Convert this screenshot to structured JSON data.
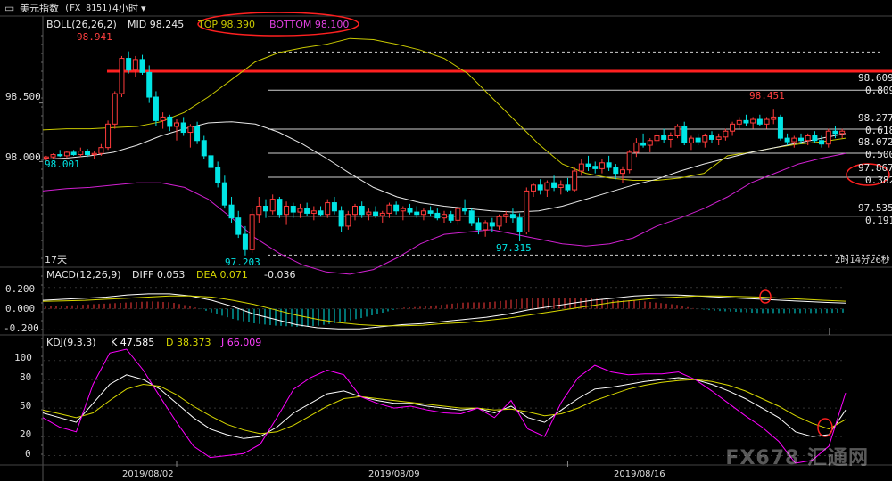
{
  "header": {
    "title": "美元指数",
    "code": "(FX 8151)",
    "period": "4小时",
    "period_arrow": "▾",
    "menu_icon": "menu-icon"
  },
  "boll_legend": {
    "label": "BOLL(26,26,2)",
    "mid": "MID 98.245",
    "top": "TOP 98.390",
    "bottom": "BOTTOM 98.100"
  },
  "macd_legend": {
    "label": "MACD(12,26,9)",
    "diff": "DIFF 0.053",
    "dea": "DEA 0.071",
    "macd": "-0.036"
  },
  "kdj_legend": {
    "label": "KDJ(9,3,3)",
    "k": "K 47.585",
    "d": "D 38.373",
    "j": "J 66.009"
  },
  "bottom_left_label": "17天",
  "countdown": "2时14分26秒",
  "watermark": "FX678 汇通网",
  "colors": {
    "up": "#ff3b3b",
    "down": "#00e5e5",
    "boll_top": "#c8c800",
    "boll_mid": "#e8e8e8",
    "boll_bottom": "#d020d0",
    "resistance": "#ff2020",
    "fib_line": "#d0d0d0",
    "k": "#ffffff",
    "d": "#d8d800",
    "j": "#ff00ff",
    "annotation": "#ff2020"
  },
  "chart_data": {
    "type": "candlestick",
    "title": "",
    "price_axis": {
      "ylim": [
        97.1,
        99.15
      ],
      "ticks": [
        "98.500",
        "98.000"
      ]
    },
    "x_axis": {
      "labels": [
        "2019/08/02",
        "2019/08/09",
        "2019/08/16"
      ],
      "label_candle_index": [
        19,
        76,
        133
      ]
    },
    "candles": [
      [
        98.03,
        98.05,
        98.0,
        98.04
      ],
      [
        98.04,
        98.07,
        98.02,
        98.06
      ],
      [
        98.06,
        98.1,
        98.04,
        98.05
      ],
      [
        98.05,
        98.09,
        98.03,
        98.08
      ],
      [
        98.08,
        98.1,
        98.05,
        98.06
      ],
      [
        98.06,
        98.12,
        98.04,
        98.09
      ],
      [
        98.09,
        98.11,
        98.04,
        98.06
      ],
      [
        98.06,
        98.09,
        98.02,
        98.07
      ],
      [
        98.07,
        98.15,
        98.05,
        98.12
      ],
      [
        98.12,
        98.35,
        98.1,
        98.32
      ],
      [
        98.32,
        98.6,
        98.28,
        98.58
      ],
      [
        98.58,
        98.9,
        98.55,
        98.88
      ],
      [
        98.88,
        98.94,
        98.75,
        98.78
      ],
      [
        98.78,
        98.9,
        98.72,
        98.87
      ],
      [
        98.87,
        98.91,
        98.74,
        98.76
      ],
      [
        98.76,
        98.82,
        98.5,
        98.55
      ],
      [
        98.55,
        98.6,
        98.3,
        98.35
      ],
      [
        98.35,
        98.42,
        98.28,
        98.38
      ],
      [
        98.38,
        98.4,
        98.26,
        98.3
      ],
      [
        98.3,
        98.36,
        98.18,
        98.33
      ],
      [
        98.33,
        98.38,
        98.22,
        98.25
      ],
      [
        98.25,
        98.32,
        98.12,
        98.3
      ],
      [
        98.3,
        98.34,
        98.15,
        98.18
      ],
      [
        98.18,
        98.22,
        98.02,
        98.05
      ],
      [
        98.05,
        98.1,
        97.92,
        97.95
      ],
      [
        97.95,
        98.0,
        97.78,
        97.82
      ],
      [
        97.82,
        97.88,
        97.6,
        97.63
      ],
      [
        97.63,
        97.7,
        97.48,
        97.52
      ],
      [
        97.52,
        97.58,
        97.35,
        97.38
      ],
      [
        97.38,
        97.45,
        97.2,
        97.25
      ],
      [
        97.25,
        97.6,
        97.22,
        97.55
      ],
      [
        97.55,
        97.7,
        97.48,
        97.62
      ],
      [
        97.62,
        97.68,
        97.52,
        97.58
      ],
      [
        97.58,
        97.72,
        97.55,
        97.68
      ],
      [
        97.68,
        97.7,
        97.52,
        97.55
      ],
      [
        97.55,
        97.66,
        97.46,
        97.62
      ],
      [
        97.62,
        97.65,
        97.52,
        97.57
      ],
      [
        97.57,
        97.64,
        97.52,
        97.6
      ],
      [
        97.6,
        97.65,
        97.54,
        97.56
      ],
      [
        97.56,
        97.62,
        97.5,
        97.58
      ],
      [
        97.58,
        97.62,
        97.53,
        97.55
      ],
      [
        97.55,
        97.68,
        97.52,
        97.65
      ],
      [
        97.65,
        97.7,
        97.55,
        97.58
      ],
      [
        97.58,
        97.62,
        97.4,
        97.45
      ],
      [
        97.45,
        97.58,
        97.42,
        97.55
      ],
      [
        97.55,
        97.64,
        97.5,
        97.62
      ],
      [
        97.62,
        97.66,
        97.52,
        97.55
      ],
      [
        97.55,
        97.6,
        97.5,
        97.57
      ],
      [
        97.57,
        97.62,
        97.52,
        97.54
      ],
      [
        97.54,
        97.58,
        97.48,
        97.56
      ],
      [
        97.56,
        97.65,
        97.52,
        97.63
      ],
      [
        97.63,
        97.66,
        97.55,
        97.58
      ],
      [
        97.58,
        97.62,
        97.5,
        97.6
      ],
      [
        97.6,
        97.64,
        97.55,
        97.57
      ],
      [
        97.57,
        97.62,
        97.52,
        97.55
      ],
      [
        97.55,
        97.6,
        97.5,
        97.58
      ],
      [
        97.58,
        97.62,
        97.53,
        97.56
      ],
      [
        97.56,
        97.6,
        97.5,
        97.52
      ],
      [
        97.52,
        97.58,
        97.48,
        97.55
      ],
      [
        97.55,
        97.58,
        97.48,
        97.5
      ],
      [
        97.5,
        97.62,
        97.46,
        97.6
      ],
      [
        97.6,
        97.68,
        97.55,
        97.58
      ],
      [
        97.58,
        97.6,
        97.45,
        97.48
      ],
      [
        97.48,
        97.52,
        97.38,
        97.42
      ],
      [
        97.42,
        97.5,
        97.36,
        97.48
      ],
      [
        97.48,
        97.52,
        97.4,
        97.45
      ],
      [
        97.45,
        97.55,
        97.42,
        97.53
      ],
      [
        97.53,
        97.58,
        97.48,
        97.55
      ],
      [
        97.55,
        97.6,
        97.48,
        97.52
      ],
      [
        97.52,
        97.56,
        97.32,
        97.4
      ],
      [
        97.4,
        97.78,
        97.38,
        97.75
      ],
      [
        97.75,
        97.82,
        97.7,
        97.8
      ],
      [
        97.8,
        97.85,
        97.72,
        97.76
      ],
      [
        97.76,
        97.84,
        97.7,
        97.82
      ],
      [
        97.82,
        97.88,
        97.75,
        97.78
      ],
      [
        97.78,
        97.84,
        97.72,
        97.8
      ],
      [
        97.8,
        97.86,
        97.74,
        97.76
      ],
      [
        97.76,
        97.95,
        97.74,
        97.92
      ],
      [
        97.92,
        98.02,
        97.88,
        97.98
      ],
      [
        97.98,
        98.05,
        97.92,
        97.96
      ],
      [
        97.96,
        98.0,
        97.9,
        97.94
      ],
      [
        97.94,
        98.02,
        97.9,
        97.99
      ],
      [
        97.99,
        98.05,
        97.92,
        97.95
      ],
      [
        97.95,
        97.98,
        97.85,
        97.9
      ],
      [
        97.9,
        97.96,
        97.82,
        97.93
      ],
      [
        97.93,
        98.1,
        97.9,
        98.08
      ],
      [
        98.08,
        98.2,
        98.04,
        98.16
      ],
      [
        98.16,
        98.24,
        98.12,
        98.14
      ],
      [
        98.14,
        98.2,
        98.08,
        98.18
      ],
      [
        98.18,
        98.26,
        98.14,
        98.22
      ],
      [
        98.22,
        98.28,
        98.16,
        98.19
      ],
      [
        98.19,
        98.25,
        98.12,
        98.22
      ],
      [
        98.22,
        98.32,
        98.2,
        98.3
      ],
      [
        98.3,
        98.34,
        98.14,
        98.16
      ],
      [
        98.16,
        98.22,
        98.1,
        98.2
      ],
      [
        98.2,
        98.24,
        98.14,
        98.17
      ],
      [
        98.17,
        98.24,
        98.12,
        98.22
      ],
      [
        98.22,
        98.26,
        98.16,
        98.19
      ],
      [
        98.19,
        98.24,
        98.14,
        98.21
      ],
      [
        98.21,
        98.28,
        98.18,
        98.26
      ],
      [
        98.26,
        98.34,
        98.22,
        98.32
      ],
      [
        98.32,
        98.38,
        98.28,
        98.35
      ],
      [
        98.35,
        98.4,
        98.3,
        98.33
      ],
      [
        98.33,
        98.38,
        98.28,
        98.36
      ],
      [
        98.36,
        98.4,
        98.3,
        98.32
      ],
      [
        98.32,
        98.38,
        98.28,
        98.36
      ],
      [
        98.36,
        98.45,
        98.32,
        98.38
      ],
      [
        98.38,
        98.4,
        98.18,
        98.2
      ],
      [
        98.2,
        98.24,
        98.14,
        98.17
      ],
      [
        98.17,
        98.22,
        98.12,
        98.2
      ],
      [
        98.2,
        98.24,
        98.15,
        98.18
      ],
      [
        98.18,
        98.24,
        98.14,
        98.22
      ],
      [
        98.22,
        98.26,
        98.16,
        98.18
      ],
      [
        98.18,
        98.22,
        98.12,
        98.15
      ],
      [
        98.15,
        98.28,
        98.12,
        98.26
      ],
      [
        98.26,
        98.3,
        98.2,
        98.24
      ],
      [
        98.24,
        98.28,
        98.2,
        98.26
      ]
    ],
    "boll": {
      "top": [
        98.27,
        98.28,
        98.28,
        98.29,
        98.3,
        98.34,
        98.42,
        98.55,
        98.7,
        98.85,
        98.93,
        98.97,
        99.0,
        99.05,
        99.04,
        99.0,
        98.95,
        98.88,
        98.75,
        98.55,
        98.35,
        98.15,
        97.98,
        97.9,
        97.86,
        97.84,
        97.84,
        97.86,
        97.9,
        98.05,
        98.08,
        98.12,
        98.15,
        98.17,
        98.2
      ],
      "mid": [
        98.02,
        98.03,
        98.05,
        98.08,
        98.14,
        98.22,
        98.28,
        98.33,
        98.34,
        98.32,
        98.25,
        98.15,
        98.03,
        97.9,
        97.78,
        97.7,
        97.65,
        97.62,
        97.6,
        97.58,
        97.57,
        97.58,
        97.62,
        97.68,
        97.74,
        97.8,
        97.85,
        97.92,
        97.98,
        98.03,
        98.08,
        98.12,
        98.16,
        98.2,
        98.24
      ],
      "bottom": [
        97.75,
        97.77,
        97.78,
        97.8,
        97.82,
        97.82,
        97.78,
        97.68,
        97.52,
        97.35,
        97.22,
        97.12,
        97.06,
        97.04,
        97.08,
        97.18,
        97.3,
        97.38,
        97.4,
        97.42,
        97.38,
        97.34,
        97.3,
        97.28,
        97.3,
        97.35,
        97.45,
        97.52,
        97.6,
        97.7,
        97.82,
        97.9,
        97.98,
        98.03,
        98.07
      ]
    },
    "annotations": {
      "high": "98.941",
      "high_candle": 12,
      "low": "97.203",
      "low_candle": 29,
      "low2": "97.315",
      "low2_candle": 69,
      "high2": "98.451",
      "high2_candle": 107,
      "start_price": "98.001",
      "resistance_level": 98.77
    },
    "fib_levels": [
      {
        "price": 98.935,
        "label": ""
      },
      {
        "price": 98.609,
        "label": "98.609",
        "pct": "0.809"
      },
      {
        "price": 98.277,
        "label": "98.277",
        "pct": "0.618"
      },
      {
        "price": 98.072,
        "label": "98.072",
        "pct": "0.500"
      },
      {
        "price": 97.867,
        "label": "97.867",
        "pct": "0.382"
      },
      {
        "price": 97.535,
        "label": "97.535",
        "pct": "0.191"
      },
      {
        "price": 97.203,
        "label": ""
      }
    ],
    "macd": {
      "ylim": [
        -0.23,
        0.24
      ],
      "ticks": [
        "0.200",
        "0.000",
        "-0.200"
      ],
      "diff": [
        0.08,
        0.09,
        0.1,
        0.11,
        0.13,
        0.14,
        0.14,
        0.12,
        0.08,
        0.02,
        -0.05,
        -0.1,
        -0.15,
        -0.18,
        -0.19,
        -0.19,
        -0.17,
        -0.15,
        -0.14,
        -0.12,
        -0.1,
        -0.08,
        -0.05,
        -0.01,
        0.02,
        0.05,
        0.08,
        0.1,
        0.12,
        0.13,
        0.13,
        0.12,
        0.11,
        0.1,
        0.09,
        0.08,
        0.07,
        0.06,
        0.053
      ],
      "dea": [
        0.07,
        0.075,
        0.08,
        0.09,
        0.1,
        0.11,
        0.12,
        0.12,
        0.11,
        0.08,
        0.04,
        -0.01,
        -0.06,
        -0.1,
        -0.13,
        -0.15,
        -0.16,
        -0.16,
        -0.155,
        -0.14,
        -0.13,
        -0.11,
        -0.09,
        -0.06,
        -0.03,
        0.0,
        0.03,
        0.06,
        0.08,
        0.1,
        0.11,
        0.12,
        0.12,
        0.115,
        0.11,
        0.1,
        0.09,
        0.08,
        0.071
      ],
      "hist": [
        0.02,
        0.03,
        0.04,
        0.05,
        0.06,
        0.07,
        0.06,
        0.02,
        -0.04,
        -0.1,
        -0.14,
        -0.16,
        -0.17,
        -0.16,
        -0.13,
        -0.09,
        -0.04,
        0.01,
        0.02,
        0.04,
        0.06,
        0.06,
        0.08,
        0.1,
        0.1,
        0.1,
        0.1,
        0.08,
        0.08,
        0.06,
        0.04,
        0.0,
        -0.02,
        -0.03,
        -0.04,
        -0.04,
        -0.04,
        -0.04,
        -0.036
      ]
    },
    "kdj": {
      "ylim": [
        -8,
        112
      ],
      "ticks": [
        "100",
        "80",
        "50",
        "20",
        "0"
      ],
      "k": [
        45,
        40,
        35,
        55,
        75,
        85,
        80,
        70,
        55,
        40,
        28,
        22,
        18,
        20,
        30,
        45,
        55,
        65,
        68,
        62,
        58,
        55,
        55,
        52,
        50,
        48,
        50,
        45,
        52,
        40,
        35,
        48,
        60,
        70,
        72,
        75,
        78,
        80,
        82,
        80,
        75,
        68,
        60,
        50,
        40,
        25,
        20,
        22,
        48
      ],
      "d": [
        48,
        44,
        40,
        45,
        58,
        70,
        75,
        73,
        64,
        52,
        42,
        33,
        27,
        23,
        25,
        32,
        42,
        52,
        60,
        62,
        60,
        58,
        56,
        54,
        52,
        50,
        50,
        48,
        49,
        46,
        42,
        44,
        50,
        58,
        64,
        70,
        74,
        77,
        79,
        80,
        78,
        74,
        68,
        60,
        52,
        42,
        34,
        28,
        38
      ],
      "j": [
        40,
        30,
        25,
        75,
        108,
        112,
        90,
        62,
        35,
        10,
        -2,
        0,
        2,
        12,
        40,
        70,
        82,
        90,
        85,
        62,
        55,
        50,
        52,
        48,
        45,
        44,
        50,
        40,
        58,
        28,
        20,
        56,
        82,
        95,
        88,
        85,
        86,
        86,
        88,
        80,
        68,
        55,
        42,
        30,
        15,
        -8,
        -5,
        10,
        66
      ]
    }
  }
}
